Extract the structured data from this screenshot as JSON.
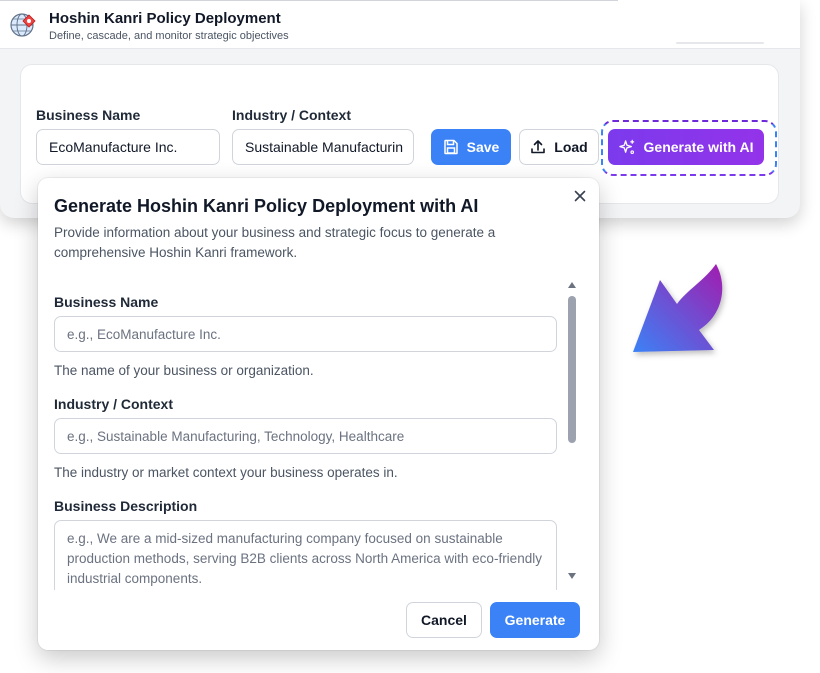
{
  "app": {
    "title": "Hoshin Kanri Policy Deployment",
    "subtitle": "Define, cascade, and monitor strategic objectives",
    "logo_icon": "globe-pin-icon"
  },
  "form": {
    "business_name_label": "Business Name",
    "business_name_value": "EcoManufacture Inc.",
    "industry_label": "Industry / Context",
    "industry_value": "Sustainable Manufacturin",
    "save_label": "Save",
    "load_label": "Load",
    "generate_ai_label": "Generate with AI"
  },
  "dialog": {
    "title": "Generate Hoshin Kanri Policy Deployment with AI",
    "description": "Provide information about your business and strategic focus to generate a comprehensive Hoshin Kanri framework.",
    "fields": {
      "business_name_label": "Business Name",
      "business_name_placeholder": "e.g., EcoManufacture Inc.",
      "business_name_help": "The name of your business or organization.",
      "industry_label": "Industry / Context",
      "industry_placeholder": "e.g., Sustainable Manufacturing, Technology, Healthcare",
      "industry_help": "The industry or market context your business operates in.",
      "description_label": "Business Description",
      "description_placeholder": "e.g., We are a mid-sized manufacturing company focused on sustainable production methods, serving B2B clients across North America with eco-friendly industrial components."
    },
    "cancel_label": "Cancel",
    "generate_label": "Generate"
  },
  "colors": {
    "primary": "#3b82f6",
    "ai_purple": "#7c3aed",
    "arrow_gradient_start": "#3b82f6",
    "arrow_gradient_end": "#9333ea"
  }
}
